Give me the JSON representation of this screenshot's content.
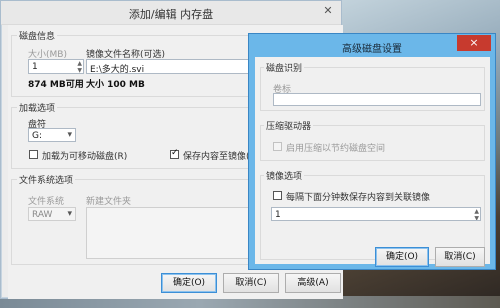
{
  "main": {
    "title": "添加/编辑 内存盘",
    "disk_info": {
      "group": "磁盘信息",
      "size_label": "大小(MB)",
      "size_value": "1",
      "free": "874 MB可用",
      "image_label": "镜像文件名称(可选)",
      "image_path": "E:\\多大的.svi",
      "image_size": "大小 100 MB"
    },
    "load_options": {
      "group": "加载选项",
      "drive_label": "盘符",
      "drive_value": "G:",
      "removable_label": "加载为可移动磁盘(R)",
      "removable_checked": false,
      "save_label": "保存内容至镜像(S)",
      "save_checked": true
    },
    "fs_options": {
      "group": "文件系统选项",
      "fs_label": "文件系统",
      "fs_value": "RAW",
      "new_folder_label": "新建文件夹"
    },
    "buttons": {
      "ok": "确定(O)",
      "cancel": "取消(C)",
      "advanced": "高级(A)"
    }
  },
  "advanced": {
    "title": "高级磁盘设置",
    "close": "×",
    "disk_id": {
      "group": "磁盘识别",
      "volume_label": "卷标",
      "volume_value": ""
    },
    "compression": {
      "group": "压缩驱动器",
      "enable_label": "启用压缩以节约磁盘空间",
      "enable_checked": false
    },
    "image_options": {
      "group": "镜像选项",
      "save_every_label": "每隔下面分钟数保存内容到关联镜像",
      "save_every_checked": false,
      "minutes_value": "1"
    },
    "buttons": {
      "ok": "确定(O)",
      "cancel": "取消(C)"
    }
  }
}
